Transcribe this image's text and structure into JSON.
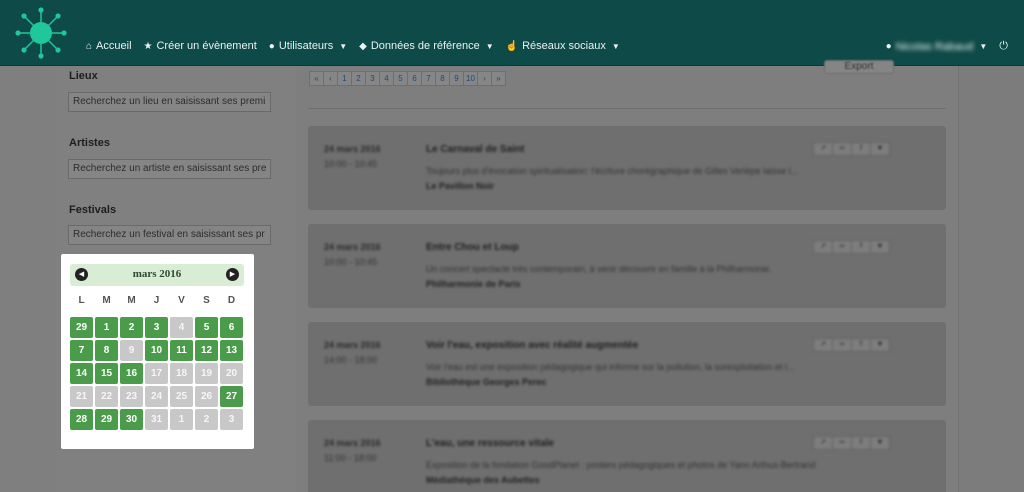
{
  "navbar": {
    "items": [
      {
        "label": "Accueil",
        "icon": "home-icon",
        "glyph": "⌂",
        "dropdown": false
      },
      {
        "label": "Créer un évènement",
        "icon": "star-icon",
        "glyph": "★",
        "dropdown": false
      },
      {
        "label": "Utilisateurs",
        "icon": "user-icon",
        "glyph": "●",
        "dropdown": true
      },
      {
        "label": "Données de référence",
        "icon": "tag-icon",
        "glyph": "◆",
        "dropdown": true
      },
      {
        "label": "Réseaux sociaux",
        "icon": "thumbs-up-icon",
        "glyph": "☝",
        "dropdown": true
      }
    ],
    "user": {
      "name": "Nicolas Rabaud",
      "icon": "user-icon",
      "logout_icon": "power-icon"
    }
  },
  "sidebar": {
    "lieux_label": "Lieux",
    "lieux_placeholder": "Recherchez un lieu en saisissant ses premi",
    "artistes_label": "Artistes",
    "artistes_placeholder": "Recherchez un artiste en saisissant ses pre",
    "festivals_label": "Festivals",
    "festivals_placeholder": "Recherchez un festival en saisissant ses pr"
  },
  "main": {
    "export_label": "Export",
    "pagination": [
      "«",
      "‹",
      "1",
      "2",
      "3",
      "4",
      "5",
      "6",
      "7",
      "8",
      "9",
      "10",
      "›",
      "»"
    ],
    "events": [
      {
        "date": "24 mars 2016",
        "time": "10:00 - 10:45",
        "title": "Le Carnaval de Saint",
        "desc": "Toujours plus d'évocation spiritualisation: l'écriture chorégraphique de Gilles Verièpe laisse l...",
        "place": "Le Pavillon Noir"
      },
      {
        "date": "24 mars 2016",
        "time": "10:00 - 10:45",
        "title": "Entre Chou et Loup",
        "desc": "Un concert spectacle très contemporain, à venir découvrir en famille à la Philharmonie.",
        "place": "Philharmonie de Paris"
      },
      {
        "date": "24 mars 2016",
        "time": "14:00 - 18:00",
        "title": "Voir l'eau, exposition avec réalité augmentée",
        "desc": "Voir l'eau est une exposition pédagogique qui informe sur la pollution, la surexploitation et l...",
        "place": "Bibliothèque Georges Perec"
      },
      {
        "date": "24 mars 2016",
        "time": "11:00 - 18:00",
        "title": "L'eau, une ressource vitale",
        "desc": "Exposition de la fondation GoodPlanet : posters pédagogiques et photos de Yann Arthus-Bertrand",
        "place": "Médiathèque des Aubettes"
      }
    ],
    "action_glyphs": [
      "↗",
      "═",
      "f",
      "▼"
    ]
  },
  "calendar": {
    "title": "mars 2016",
    "prev_icon": "chevron-left-icon",
    "next_icon": "chevron-right-icon",
    "weekdays": [
      "L",
      "M",
      "M",
      "J",
      "V",
      "S",
      "D"
    ],
    "days": [
      {
        "n": "29",
        "active": true
      },
      {
        "n": "1",
        "active": true
      },
      {
        "n": "2",
        "active": true
      },
      {
        "n": "3",
        "active": true
      },
      {
        "n": "4",
        "active": false
      },
      {
        "n": "5",
        "active": true
      },
      {
        "n": "6",
        "active": true
      },
      {
        "n": "7",
        "active": true
      },
      {
        "n": "8",
        "active": true
      },
      {
        "n": "9",
        "active": false
      },
      {
        "n": "10",
        "active": true
      },
      {
        "n": "11",
        "active": true
      },
      {
        "n": "12",
        "active": true
      },
      {
        "n": "13",
        "active": true
      },
      {
        "n": "14",
        "active": true
      },
      {
        "n": "15",
        "active": true
      },
      {
        "n": "16",
        "active": true
      },
      {
        "n": "17",
        "active": false
      },
      {
        "n": "18",
        "active": false
      },
      {
        "n": "19",
        "active": false
      },
      {
        "n": "20",
        "active": false
      },
      {
        "n": "21",
        "active": false
      },
      {
        "n": "22",
        "active": false
      },
      {
        "n": "23",
        "active": false
      },
      {
        "n": "24",
        "active": false
      },
      {
        "n": "25",
        "active": false
      },
      {
        "n": "26",
        "active": false
      },
      {
        "n": "27",
        "active": true
      },
      {
        "n": "28",
        "active": true
      },
      {
        "n": "29",
        "active": true
      },
      {
        "n": "30",
        "active": true
      },
      {
        "n": "31",
        "active": false
      },
      {
        "n": "1",
        "active": false
      },
      {
        "n": "2",
        "active": false
      },
      {
        "n": "3",
        "active": false
      }
    ]
  },
  "colors": {
    "navbar": "#0e4a47",
    "logo": "#1fc79a",
    "active_day": "#4a9c4a",
    "inactive_day": "#c8c8c8",
    "overlay": "#7f7f7f"
  }
}
